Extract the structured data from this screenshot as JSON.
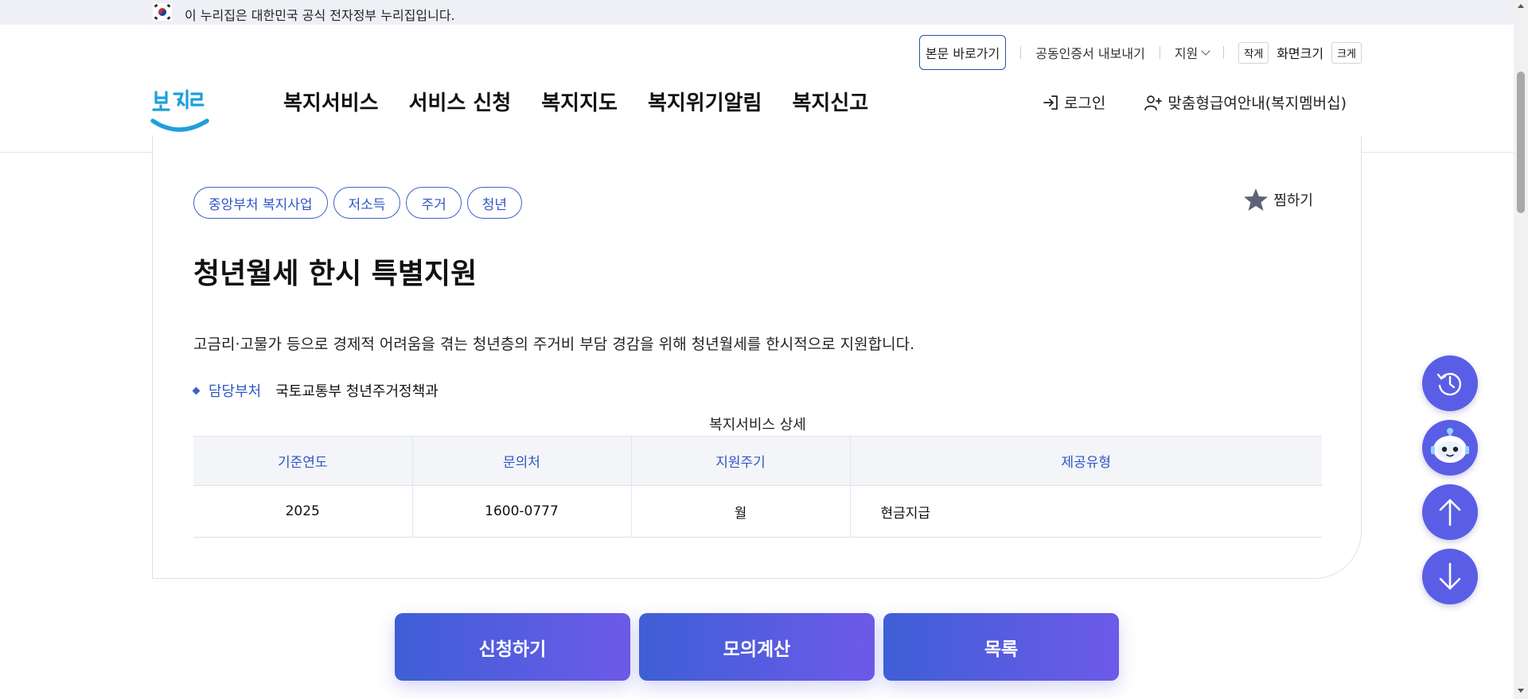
{
  "gov_banner": {
    "text": "이 누리집은 대한민국 공식 전자정부 누리집입니다."
  },
  "utility": {
    "skip": "본문 바로가기",
    "cert_export": "공동인증서 내보내기",
    "support": "지원",
    "font_small": "작게",
    "font_label": "화면크기",
    "font_large": "크게"
  },
  "logo": {
    "text": "복지로"
  },
  "gnb": [
    "복지서비스",
    "서비스 신청",
    "복지지도",
    "복지위기알림",
    "복지신고"
  ],
  "member": {
    "login": "로그인",
    "custom_notice": "맞춤형급여안내(복지멤버십)"
  },
  "service": {
    "tags": [
      "중앙부처 복지사업",
      "저소득",
      "주거",
      "청년"
    ],
    "favorite": "찜하기",
    "title": "청년월세 한시 특별지원",
    "description": "고금리·고물가 등으로 경제적 어려움을 겪는 청년층의 주거비 부담 경감을 위해 청년월세를 한시적으로 지원합니다.",
    "dept_label": "담당부처",
    "dept_value": "국토교통부 청년주거정책과"
  },
  "detail_table": {
    "caption": "복지서비스 상세",
    "headers": [
      "기준연도",
      "문의처",
      "지원주기",
      "제공유형"
    ],
    "row": [
      "2025",
      "1600-0777",
      "월",
      "현금지급"
    ]
  },
  "actions": {
    "apply": "신청하기",
    "simulate": "모의계산",
    "list": "목록"
  },
  "colors": {
    "accent": "#2f56c8",
    "button_start": "#3e5fd6",
    "button_end": "#6d5ae8",
    "fab": "#5a5ee6"
  }
}
